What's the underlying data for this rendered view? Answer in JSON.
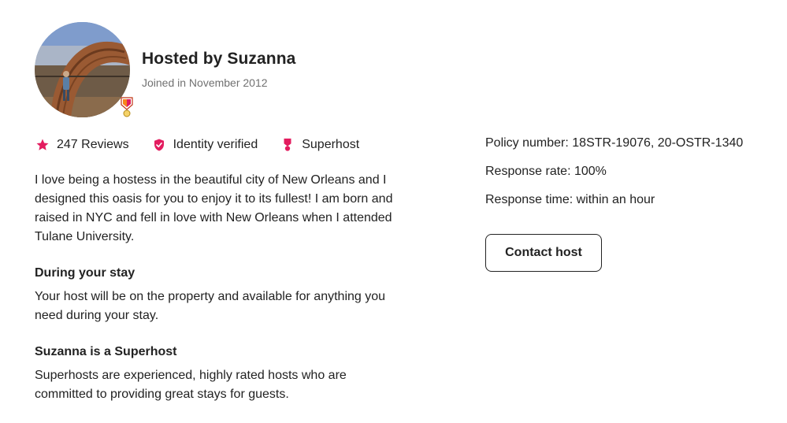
{
  "host": {
    "title": "Hosted by Suzanna",
    "joined": "Joined in November 2012"
  },
  "stats": {
    "reviews": {
      "label": "247 Reviews",
      "icon": "star-icon"
    },
    "identity": {
      "label": "Identity verified",
      "icon": "shield-check-icon"
    },
    "superhost": {
      "label": "Superhost",
      "icon": "medal-icon"
    }
  },
  "about": "I love being a hostess in the beautiful city of New Orleans and I designed this oasis for you to enjoy it to its fullest! I am born and raised in NYC and fell in love with New Orleans when I attended Tulane University.",
  "during_stay": {
    "heading": "During your stay",
    "body": "Your host will be on the property and available for anything you need during your stay."
  },
  "superhost_info": {
    "heading": "Suzanna is a Superhost",
    "body": "Superhosts are experienced, highly rated hosts who are committed to providing great stays for guests."
  },
  "details": {
    "policy": "Policy number: 18STR-19076, 20-OSTR-1340",
    "response_rate": "Response rate: 100%",
    "response_time": "Response time: within an hour"
  },
  "contact_label": "Contact host",
  "colors": {
    "accent": "#c13515",
    "superhost_pink": "#e31c5f",
    "text": "#222222",
    "muted": "#717171"
  }
}
